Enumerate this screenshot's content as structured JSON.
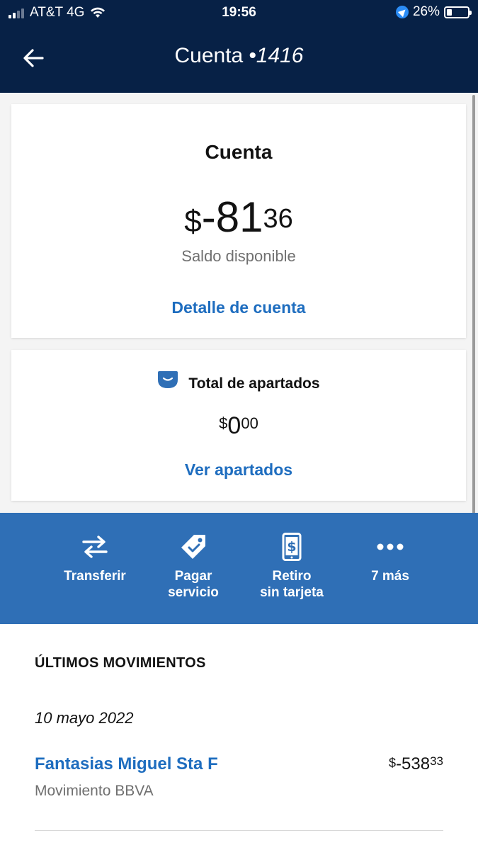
{
  "status_bar": {
    "carrier": "AT&T 4G",
    "time": "19:56",
    "battery": "26%",
    "battery_level": 0.26
  },
  "header": {
    "title": "Cuenta",
    "account_suffix": "•1416"
  },
  "account_card": {
    "title": "Cuenta",
    "currency": "$",
    "balance_whole": "-81",
    "balance_cents": "36",
    "balance_label": "Saldo disponible",
    "detail_link": "Detalle de cuenta"
  },
  "savings_card": {
    "title": "Total de apartados",
    "currency": "$",
    "amount_whole": "0",
    "amount_cents": "00",
    "link": "Ver apartados"
  },
  "actions": [
    {
      "icon": "transfer-arrows-icon",
      "line1": "Transferir",
      "line2": ""
    },
    {
      "icon": "price-tag-icon",
      "line1": "Pagar",
      "line2": "servicio"
    },
    {
      "icon": "phone-dollar-icon",
      "line1": "Retiro",
      "line2": "sin tarjeta"
    },
    {
      "icon": "more-dots-icon",
      "line1": "7 más",
      "line2": ""
    }
  ],
  "movements": {
    "section_title": "ÚLTIMOS MOVIMIENTOS",
    "date": "10 mayo 2022",
    "items": [
      {
        "merchant": "Fantasias Miguel Sta F",
        "type": "Movimiento BBVA",
        "currency": "$",
        "amount_whole": "-538",
        "amount_cents": "33"
      }
    ]
  },
  "colors": {
    "header_bg": "#072146",
    "action_bar_bg": "#2f6fb6",
    "link": "#1e6dbf"
  }
}
